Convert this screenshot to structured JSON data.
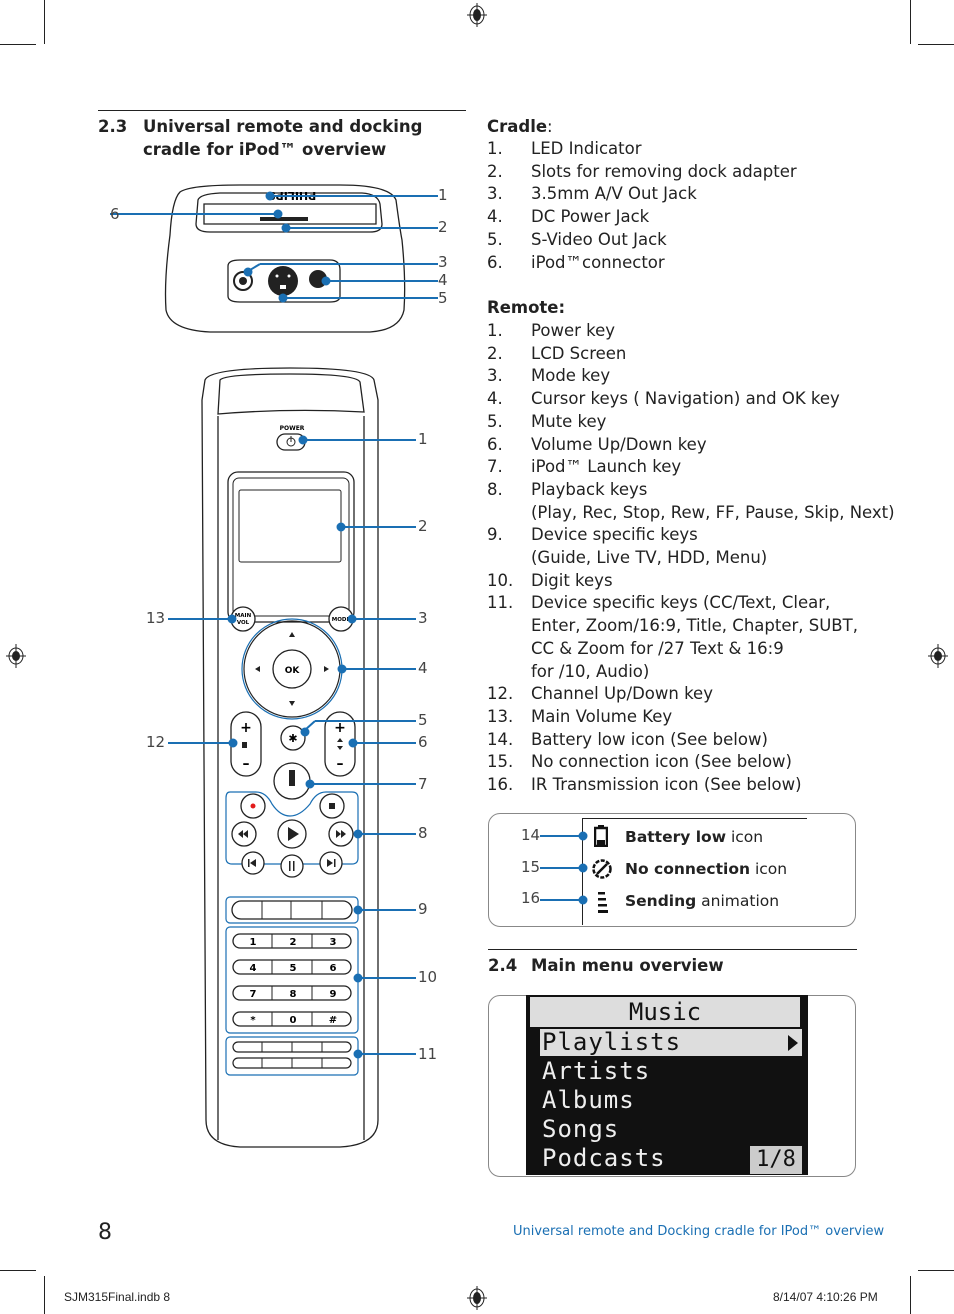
{
  "section_2_3": {
    "number": "2.3",
    "title": "Universal remote and docking cradle for iPod™ overview"
  },
  "cradle": {
    "heading": "Cradle",
    "heading_suffix": ":",
    "items": [
      {
        "n": "1.",
        "text": "LED Indicator"
      },
      {
        "n": "2.",
        "text": "Slots for removing dock adapter"
      },
      {
        "n": "3.",
        "text": "3.5mm A/V Out Jack"
      },
      {
        "n": "4.",
        "text": "DC Power Jack"
      },
      {
        "n": "5.",
        "text": "S-Video Out Jack"
      },
      {
        "n": "6.",
        "text": "iPod™connector"
      }
    ],
    "callouts": [
      "1",
      "2",
      "3",
      "4",
      "5",
      "6"
    ],
    "brand": "PHILIPS"
  },
  "remote": {
    "heading": "Remote:",
    "items": [
      {
        "n": "1.",
        "text": "Power key"
      },
      {
        "n": "2.",
        "text": "LCD Screen"
      },
      {
        "n": "3.",
        "text": "Mode key"
      },
      {
        "n": "4.",
        "text": "Cursor keys ( Navigation)  and OK key"
      },
      {
        "n": "5.",
        "text": "Mute key"
      },
      {
        "n": "6.",
        "text": "Volume Up/Down key"
      },
      {
        "n": "7.",
        "text": "iPod™ Launch key"
      },
      {
        "n": "8.",
        "text": "Playback keys\n(Play, Rec, Stop, Rew, FF, Pause, Skip, Next)"
      },
      {
        "n": "9.",
        "text": "Device specific keys\n(Guide, Live TV, HDD, Menu)"
      },
      {
        "n": "10.",
        "text": "Digit keys"
      },
      {
        "n": "11.",
        "text": "Device specific keys (CC/Text, Clear,\nEnter, Zoom/16:9, Title, Chapter, SUBT,\nCC & Zoom for /27 Text & 16:9\nfor /10,  Audio)"
      },
      {
        "n": "12.",
        "text": "Channel Up/Down key"
      },
      {
        "n": "13.",
        "text": "Main Volume Key"
      },
      {
        "n": "14.",
        "text": "Battery low icon (See below)"
      },
      {
        "n": "15.",
        "text": "No connection icon (See below)"
      },
      {
        "n": "16.",
        "text": "IR Transmission icon (See below)"
      }
    ],
    "callouts": [
      "1",
      "2",
      "3",
      "4",
      "5",
      "6",
      "7",
      "8",
      "9",
      "10",
      "11",
      "12",
      "13"
    ],
    "labels": {
      "power": "POWER",
      "main_vol_1": "MAIN",
      "main_vol_2": "VOL",
      "mode": "MODE",
      "ok": "OK",
      "digits": [
        "1",
        "2",
        "3",
        "4",
        "5",
        "6",
        "7",
        "8",
        "9",
        "*",
        "0",
        "#"
      ]
    }
  },
  "status_icons": [
    {
      "num": "14",
      "bold": "Battery low",
      "rest": " icon",
      "icon": "battery-low-icon"
    },
    {
      "num": "15",
      "bold": "No connection",
      "rest": " icon",
      "icon": "no-connection-icon"
    },
    {
      "num": "16",
      "bold": "Sending",
      "rest": " animation",
      "icon": "sending-animation-icon"
    }
  ],
  "section_2_4": {
    "number": "2.4",
    "title": "Main menu overview"
  },
  "main_menu": {
    "title": "Music",
    "items": [
      "Playlists",
      "Artists",
      "Albums",
      "Songs",
      "Podcasts"
    ],
    "selected": "Playlists",
    "page": "1/8"
  },
  "footer": {
    "page_number": "8",
    "running_title": "Universal remote and Docking cradle for IPod™ overview",
    "slug_file": "SJM315Final.indb   8",
    "slug_date": "8/14/07   4:10:26 PM"
  },
  "colors": {
    "accent_blue": "#1a6fb3",
    "rec_red": "#e21b1b"
  }
}
